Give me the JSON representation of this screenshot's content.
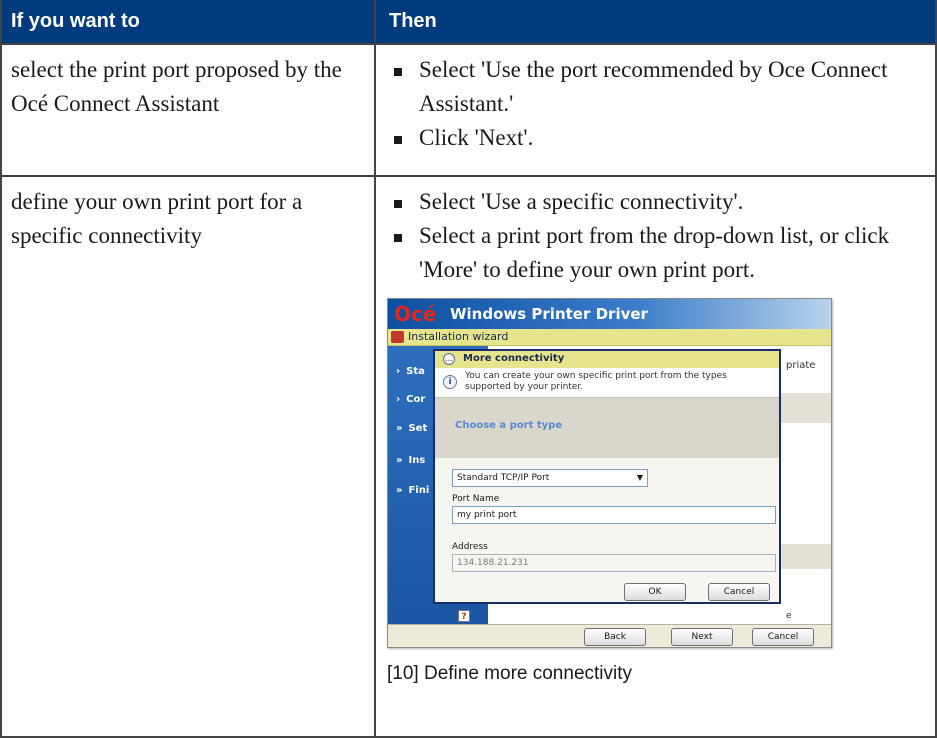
{
  "table": {
    "headers": {
      "col1": "If you want to",
      "col2": "Then"
    },
    "rows": [
      {
        "condition": "select the print port proposed by the Océ Connect Assistant",
        "steps": [
          "Select 'Use the port recommended by Oce Connect Assistant.'",
          "Click 'Next'."
        ]
      },
      {
        "condition": "define your own print port for a specific connectivity",
        "steps": [
          "Select 'Use a specific connectivity'.",
          "Select a print port from the drop-down list, or click 'More' to define your own print port."
        ]
      }
    ]
  },
  "screenshot": {
    "logo": "Océ",
    "app_title": "Windows Printer Driver",
    "wizard_label": "Installation wizard",
    "steps": [
      {
        "label": "Sta",
        "icon": "chevron-right-icon"
      },
      {
        "label": "Cor",
        "icon": "chevron-right-icon"
      },
      {
        "label": "Set",
        "icon": "double-chevron-icon"
      },
      {
        "label": "Ins",
        "icon": "double-chevron-icon"
      },
      {
        "label": "Fini",
        "icon": "double-chevron-icon"
      }
    ],
    "right_partial_text": "priate",
    "right_partial_small": "e",
    "help_glyph": "?",
    "buttons": {
      "back": "Back",
      "next": "Next",
      "cancel": "Cancel"
    },
    "dialog": {
      "title": "More connectivity",
      "info_text": "You can create your own specific print port from the types supported by your printer.",
      "choose_label": "Choose a port type",
      "port_type_value": "Standard TCP/IP Port",
      "port_name_label": "Port Name",
      "port_name_value": "my print port",
      "address_label": "Address",
      "address_value": "134.188.21.231",
      "ok_label": "OK",
      "cancel_label": "Cancel"
    },
    "colors": {
      "banner": "#0c4fa0",
      "logo": "#e2271c",
      "wizard_bar": "#e6e48c",
      "left_panel": "#2d6fbd"
    }
  },
  "caption": "[10] Define more connectivity",
  "colors": {
    "header_bg": "#003c7d",
    "header_text": "#ffffff",
    "border": "#444444"
  }
}
